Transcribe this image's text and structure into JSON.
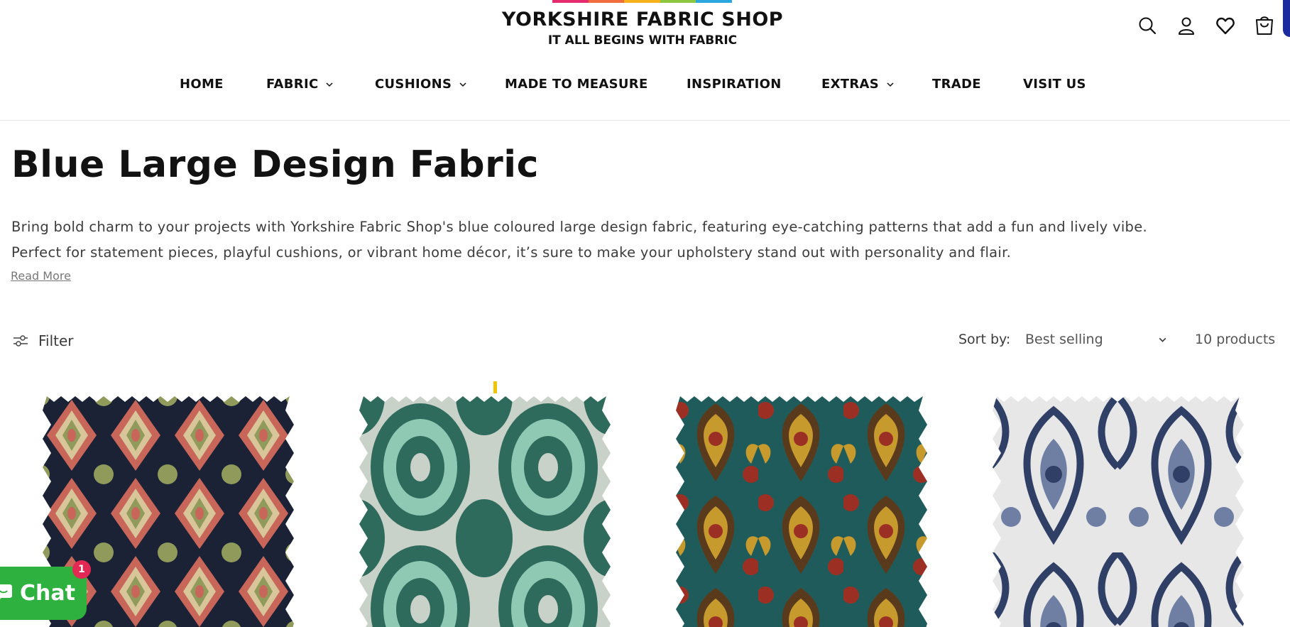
{
  "header": {
    "brand_colors": [
      "#e62a6f",
      "#f26d3d",
      "#f5b21b",
      "#8dc63f",
      "#2aa7df"
    ],
    "logo_title": "YORKSHIRE FABRIC SHOP",
    "logo_tagline": "IT ALL BEGINS WITH FABRIC",
    "icons": [
      "search-icon",
      "account-icon",
      "wishlist-heart-icon",
      "cart-icon"
    ]
  },
  "nav": {
    "items": [
      {
        "label": "HOME",
        "dropdown": false
      },
      {
        "label": "FABRIC",
        "dropdown": true
      },
      {
        "label": "CUSHIONS",
        "dropdown": true
      },
      {
        "label": "MADE TO MEASURE",
        "dropdown": false
      },
      {
        "label": "INSPIRATION",
        "dropdown": false
      },
      {
        "label": "EXTRAS",
        "dropdown": true
      },
      {
        "label": "TRADE",
        "dropdown": false
      },
      {
        "label": "VISIT US",
        "dropdown": false
      }
    ]
  },
  "collection": {
    "title": "Blue Large Design Fabric",
    "description_line1": "Bring bold charm to your projects with Yorkshire Fabric Shop's blue coloured large design fabric, featuring eye-catching patterns that add a fun and lively vibe.",
    "description_line2": "Perfect for statement pieces, playful cushions, or vibrant home décor, it’s sure to make your upholstery stand out with personality and flair.",
    "read_more": "Read More"
  },
  "toolbar": {
    "filter_label": "Filter",
    "sort_label": "Sort by:",
    "sort_value": "Best selling",
    "product_count": "10 products"
  },
  "products": [
    {
      "image": "navy-ikat-tapestry-swatch",
      "colors": [
        "#1b2235",
        "#c8665a",
        "#d8c69a",
        "#8f9a5b"
      ]
    },
    {
      "image": "green-ikat-swatch",
      "colors": [
        "#2f6b5c",
        "#8fc9b4",
        "#c9d2c8"
      ]
    },
    {
      "image": "teal-floral-tapestry-swatch",
      "colors": [
        "#1f5b5a",
        "#c79a2e",
        "#9c2f24",
        "#5a3a1c"
      ]
    },
    {
      "image": "navy-damask-swatch",
      "colors": [
        "#e7e7e8",
        "#2f3f66",
        "#6f7fa3"
      ]
    }
  ],
  "chat": {
    "label": "Chat",
    "badge": "1",
    "color": "#2eb13e"
  }
}
